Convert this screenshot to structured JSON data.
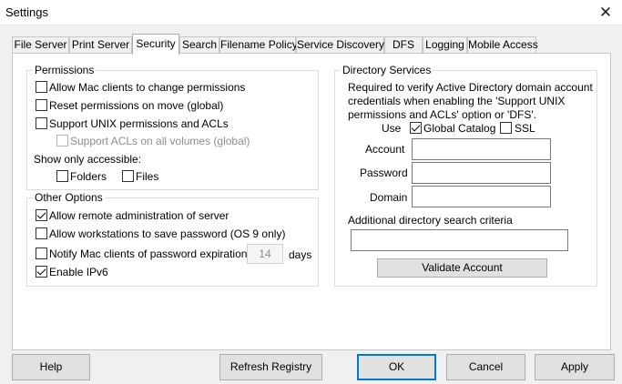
{
  "window": {
    "title": "Settings",
    "close_glyph": "✕"
  },
  "tabs": [
    "File Server",
    "Print Server",
    "Security",
    "Search",
    "Filename Policy",
    "Service Discovery",
    "DFS",
    "Logging",
    "Mobile Access"
  ],
  "active_tab": "Security",
  "permissions": {
    "legend": "Permissions",
    "allow_mac_change": {
      "label": "Allow Mac clients to change permissions",
      "checked": false
    },
    "reset_on_move": {
      "label": "Reset permissions on move (global)",
      "checked": false
    },
    "support_unix": {
      "label": "Support UNIX permissions and ACLs",
      "checked": false
    },
    "support_acls_all": {
      "label": "Support ACLs on all volumes (global)",
      "checked": false,
      "disabled": true
    },
    "show_only_label": "Show only accessible:",
    "folders": {
      "label": "Folders",
      "checked": false
    },
    "files": {
      "label": "Files",
      "checked": false
    }
  },
  "other_options": {
    "legend": "Other Options",
    "allow_remote_admin": {
      "label": "Allow remote administration of server",
      "checked": true
    },
    "allow_save_password": {
      "label": "Allow workstations to save password (OS 9 only)",
      "checked": false
    },
    "notify_expiration": {
      "label": "Notify Mac clients of password expiration in",
      "checked": false
    },
    "days_value": "14",
    "days_label": "days",
    "enable_ipv6": {
      "label": "Enable IPv6",
      "checked": true
    }
  },
  "directory_services": {
    "legend": "Directory Services",
    "description_lines": [
      "Required to verify Active Directory domain account",
      "credentials when enabling the 'Support UNIX",
      "permissions and ACLs' option or 'DFS'."
    ],
    "use_label": "Use",
    "global_catalog": {
      "label": "Global Catalog",
      "checked": true
    },
    "ssl": {
      "label": "SSL",
      "checked": false
    },
    "account_label": "Account",
    "account_value": "",
    "password_label": "Password",
    "password_value": "",
    "domain_label": "Domain",
    "domain_value": "",
    "criteria_label": "Additional directory search criteria",
    "criteria_value": "",
    "validate_button": "Validate Account"
  },
  "footer": {
    "help": "Help",
    "refresh": "Refresh Registry",
    "ok": "OK",
    "cancel": "Cancel",
    "apply": "Apply"
  },
  "colors": {
    "accent": "#0078d7",
    "window_bg": "#f0f0f0",
    "panel_bg": "#ffffff"
  }
}
